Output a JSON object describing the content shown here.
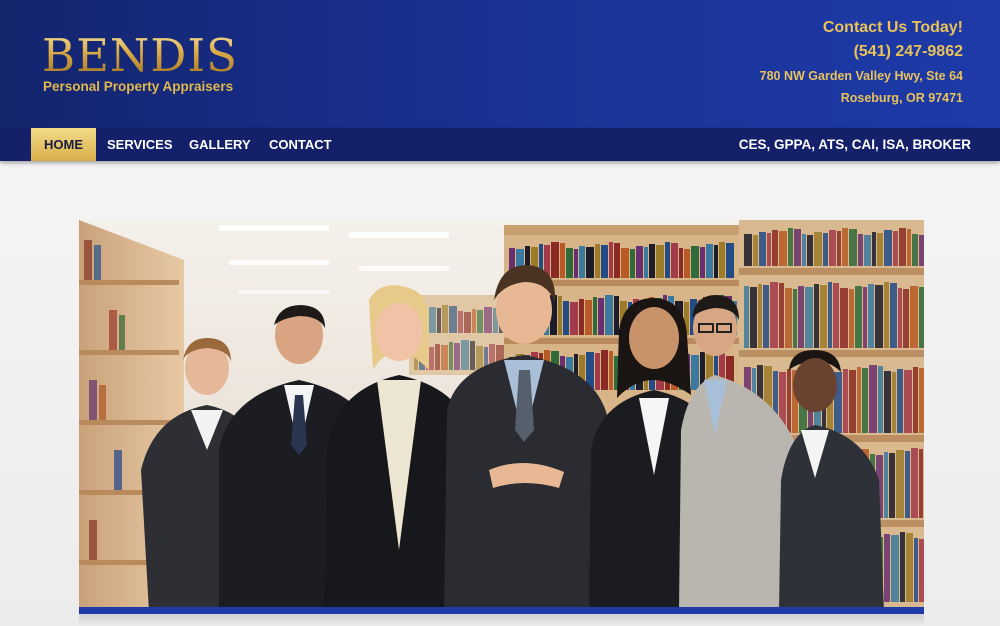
{
  "brand": {
    "name": "BENDIS",
    "tagline": "Personal Property Appraisers"
  },
  "contact": {
    "heading": "Contact Us Today!",
    "phone": "(541) 247-9862",
    "street": "780 NW Garden Valley Hwy, Ste 64",
    "city": "Roseburg, OR 97471"
  },
  "nav": {
    "items": [
      {
        "label": "HOME",
        "active": true
      },
      {
        "label": "SERVICES",
        "active": false
      },
      {
        "label": "GALLERY",
        "active": false
      },
      {
        "label": "CONTACT",
        "active": false
      }
    ],
    "certifications": "CES, GPPA, ATS, CAI, ISA, BROKER"
  },
  "hero": {
    "image_icon": "team-photo-in-library",
    "colors": {
      "accent_bar": "#1d3aa8",
      "shelf_wood": "#d8b489"
    }
  },
  "colors": {
    "header_blue": "#1a3397",
    "nav_blue": "#14206a",
    "gold": "#e9c25a"
  }
}
